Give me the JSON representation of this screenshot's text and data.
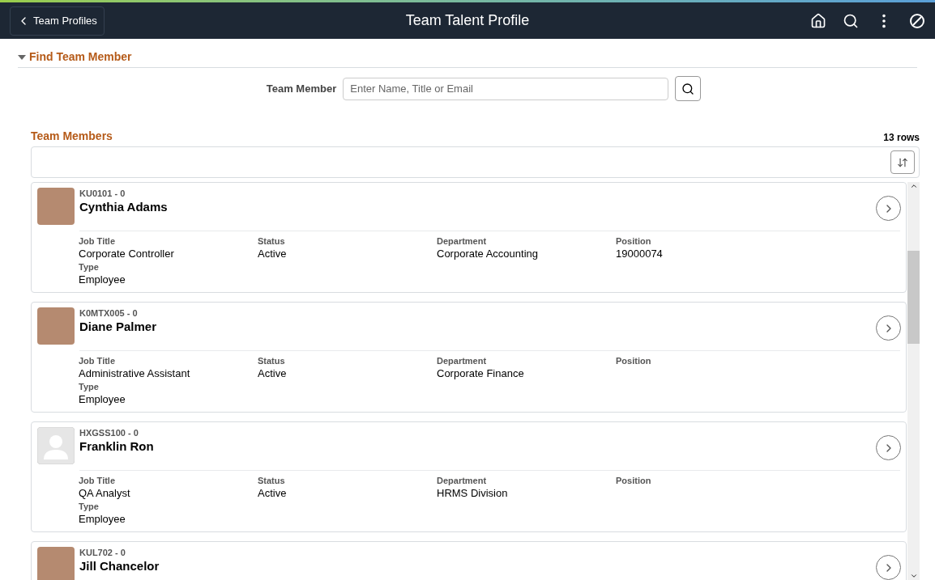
{
  "header": {
    "back_button": "Team Profiles",
    "title": "Team Talent Profile"
  },
  "find_section": {
    "title": "Find Team Member",
    "expanded": true,
    "field_label": "Team Member",
    "placeholder": "Enter Name, Title or Email"
  },
  "list": {
    "title": "Team Members",
    "row_count": "13 rows"
  },
  "members": [
    {
      "kind": "photo",
      "id": "KU0101 - 0",
      "name": "Cynthia Adams",
      "fields": [
        {
          "label": "Job Title",
          "value": "Corporate Controller"
        },
        {
          "label": "Status",
          "value": "Active"
        },
        {
          "label": "Department",
          "value": "Corporate Accounting"
        },
        {
          "label": "Position",
          "value": "19000074"
        },
        {
          "label": "Type",
          "value": "Employee"
        }
      ]
    },
    {
      "kind": "photo",
      "id": "K0MTX005 - 0",
      "name": "Diane Palmer",
      "fields": [
        {
          "label": "Job Title",
          "value": "Administrative Assistant"
        },
        {
          "label": "Status",
          "value": "Active"
        },
        {
          "label": "Department",
          "value": "Corporate Finance"
        },
        {
          "label": "Position"
        },
        {
          "label": "Type",
          "value": "Employee"
        }
      ]
    },
    {
      "kind": "silhouette",
      "id": "HXGSS100 - 0",
      "name": "Franklin Ron",
      "fields": [
        {
          "label": "Job Title",
          "value": "QA Analyst"
        },
        {
          "label": "Status",
          "value": "Active"
        },
        {
          "label": "Department",
          "value": "HRMS Division"
        },
        {
          "label": "Position"
        },
        {
          "label": "Type",
          "value": "Employee"
        }
      ]
    },
    {
      "kind": "photo",
      "id": "KUL702 - 0",
      "name": "Jill Chancelor"
    }
  ]
}
